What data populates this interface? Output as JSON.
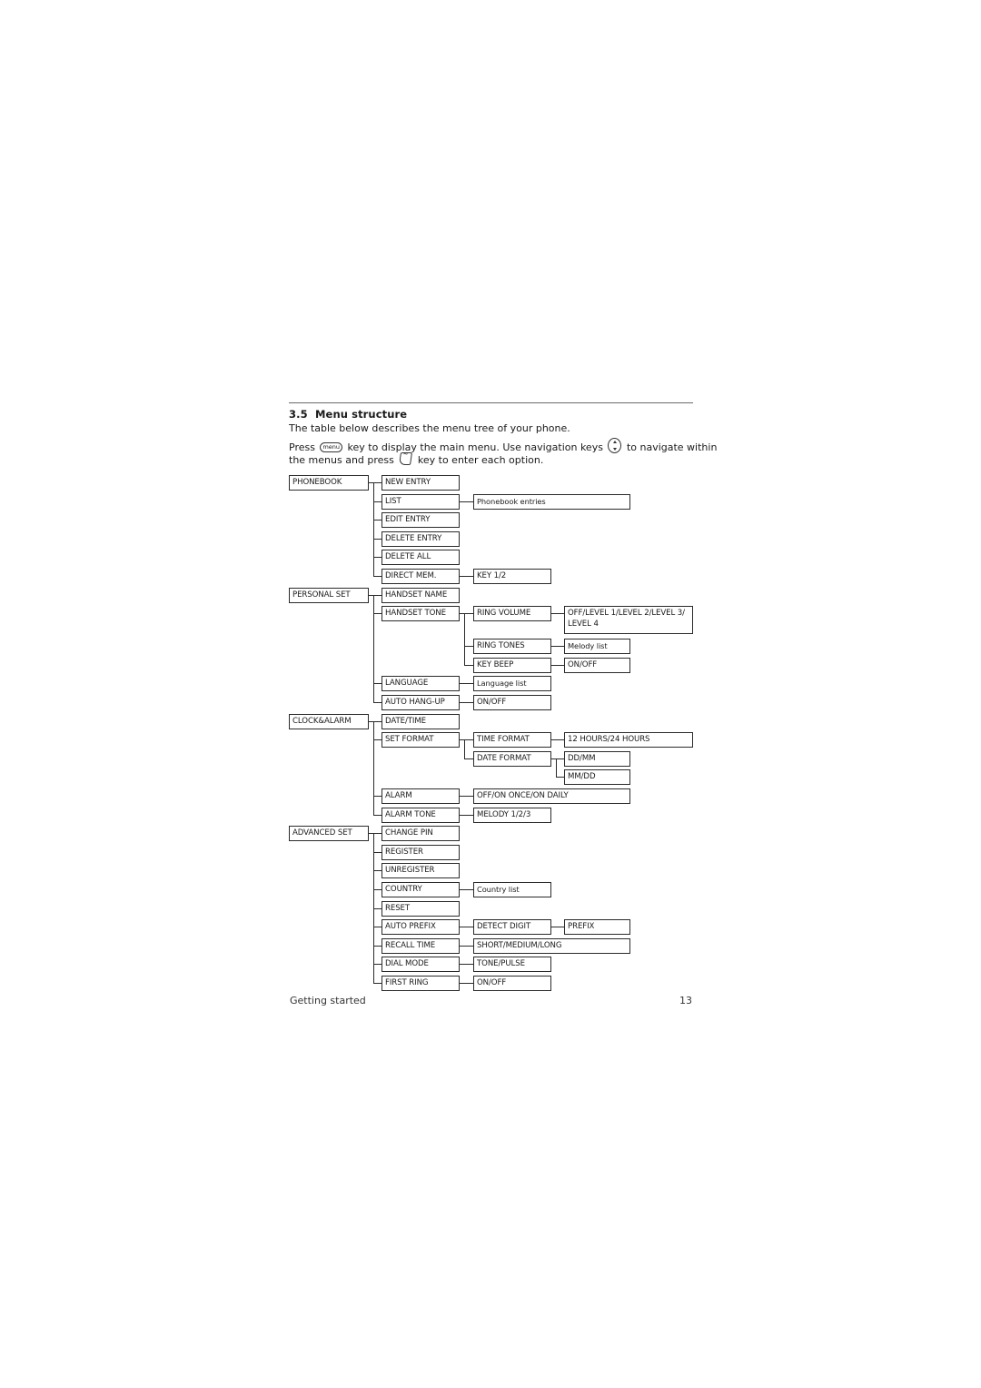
{
  "section": {
    "number": "3.5",
    "title": "Menu structure",
    "intro": "The table below describes the menu tree of your phone.",
    "instr_a": "Press",
    "menu_key_label": "menu",
    "instr_b": "key to display the main menu. Use navigation keys",
    "instr_c": "to navigate within",
    "instr_d": "the menus and press",
    "instr_e": "key to enter each option.",
    "icons": {
      "menu_key": "menu-key-icon",
      "nav_keys": "navigation-keys-icon",
      "ok_key": "ok-key-icon"
    }
  },
  "menu_tree": [
    {
      "label": "PHONEBOOK",
      "children": [
        {
          "label": "NEW ENTRY"
        },
        {
          "label": "LIST",
          "children": [
            {
              "label": "Phonebook entries"
            }
          ]
        },
        {
          "label": "EDIT ENTRY"
        },
        {
          "label": "DELETE ENTRY"
        },
        {
          "label": "DELETE ALL"
        },
        {
          "label": "DIRECT MEM.",
          "children": [
            {
              "label": "KEY 1/2"
            }
          ]
        }
      ]
    },
    {
      "label": "PERSONAL SET",
      "children": [
        {
          "label": "HANDSET NAME"
        },
        {
          "label": "HANDSET TONE",
          "children": [
            {
              "label": "RING VOLUME",
              "children": [
                {
                  "label": "OFF/LEVEL 1/LEVEL 2/LEVEL 3/ LEVEL 4"
                }
              ]
            },
            {
              "label": "RING TONES",
              "children": [
                {
                  "label": "Melody list"
                }
              ]
            },
            {
              "label": "KEY BEEP",
              "children": [
                {
                  "label": "ON/OFF"
                }
              ]
            }
          ]
        },
        {
          "label": "LANGUAGE",
          "children": [
            {
              "label": "Language list"
            }
          ]
        },
        {
          "label": "AUTO HANG-UP",
          "children": [
            {
              "label": "ON/OFF"
            }
          ]
        }
      ]
    },
    {
      "label": "CLOCK&ALARM",
      "children": [
        {
          "label": "DATE/TIME"
        },
        {
          "label": "SET FORMAT",
          "children": [
            {
              "label": "TIME FORMAT",
              "children": [
                {
                  "label": "12 HOURS/24 HOURS"
                }
              ]
            },
            {
              "label": "DATE FORMAT",
              "children": [
                {
                  "label": "DD/MM"
                },
                {
                  "label": "MM/DD"
                }
              ]
            }
          ]
        },
        {
          "label": "ALARM",
          "children": [
            {
              "label": "OFF/ON ONCE/ON DAILY"
            }
          ]
        },
        {
          "label": "ALARM TONE",
          "children": [
            {
              "label": "MELODY 1/2/3"
            }
          ]
        }
      ]
    },
    {
      "label": "ADVANCED SET",
      "children": [
        {
          "label": "CHANGE PIN"
        },
        {
          "label": "REGISTER"
        },
        {
          "label": "UNREGISTER"
        },
        {
          "label": "COUNTRY",
          "children": [
            {
              "label": "Country list"
            }
          ]
        },
        {
          "label": "RESET"
        },
        {
          "label": "AUTO PREFIX",
          "children": [
            {
              "label": "DETECT DIGIT",
              "children": [
                {
                  "label": "PREFIX"
                }
              ]
            }
          ]
        },
        {
          "label": "RECALL TIME",
          "children": [
            {
              "label": "SHORT/MEDIUM/LONG"
            }
          ]
        },
        {
          "label": "DIAL MODE",
          "children": [
            {
              "label": "TONE/PULSE"
            }
          ]
        },
        {
          "label": "FIRST RING",
          "children": [
            {
              "label": "ON/OFF"
            }
          ]
        }
      ]
    }
  ],
  "footer": {
    "section_name": "Getting started",
    "page_number": "13"
  }
}
